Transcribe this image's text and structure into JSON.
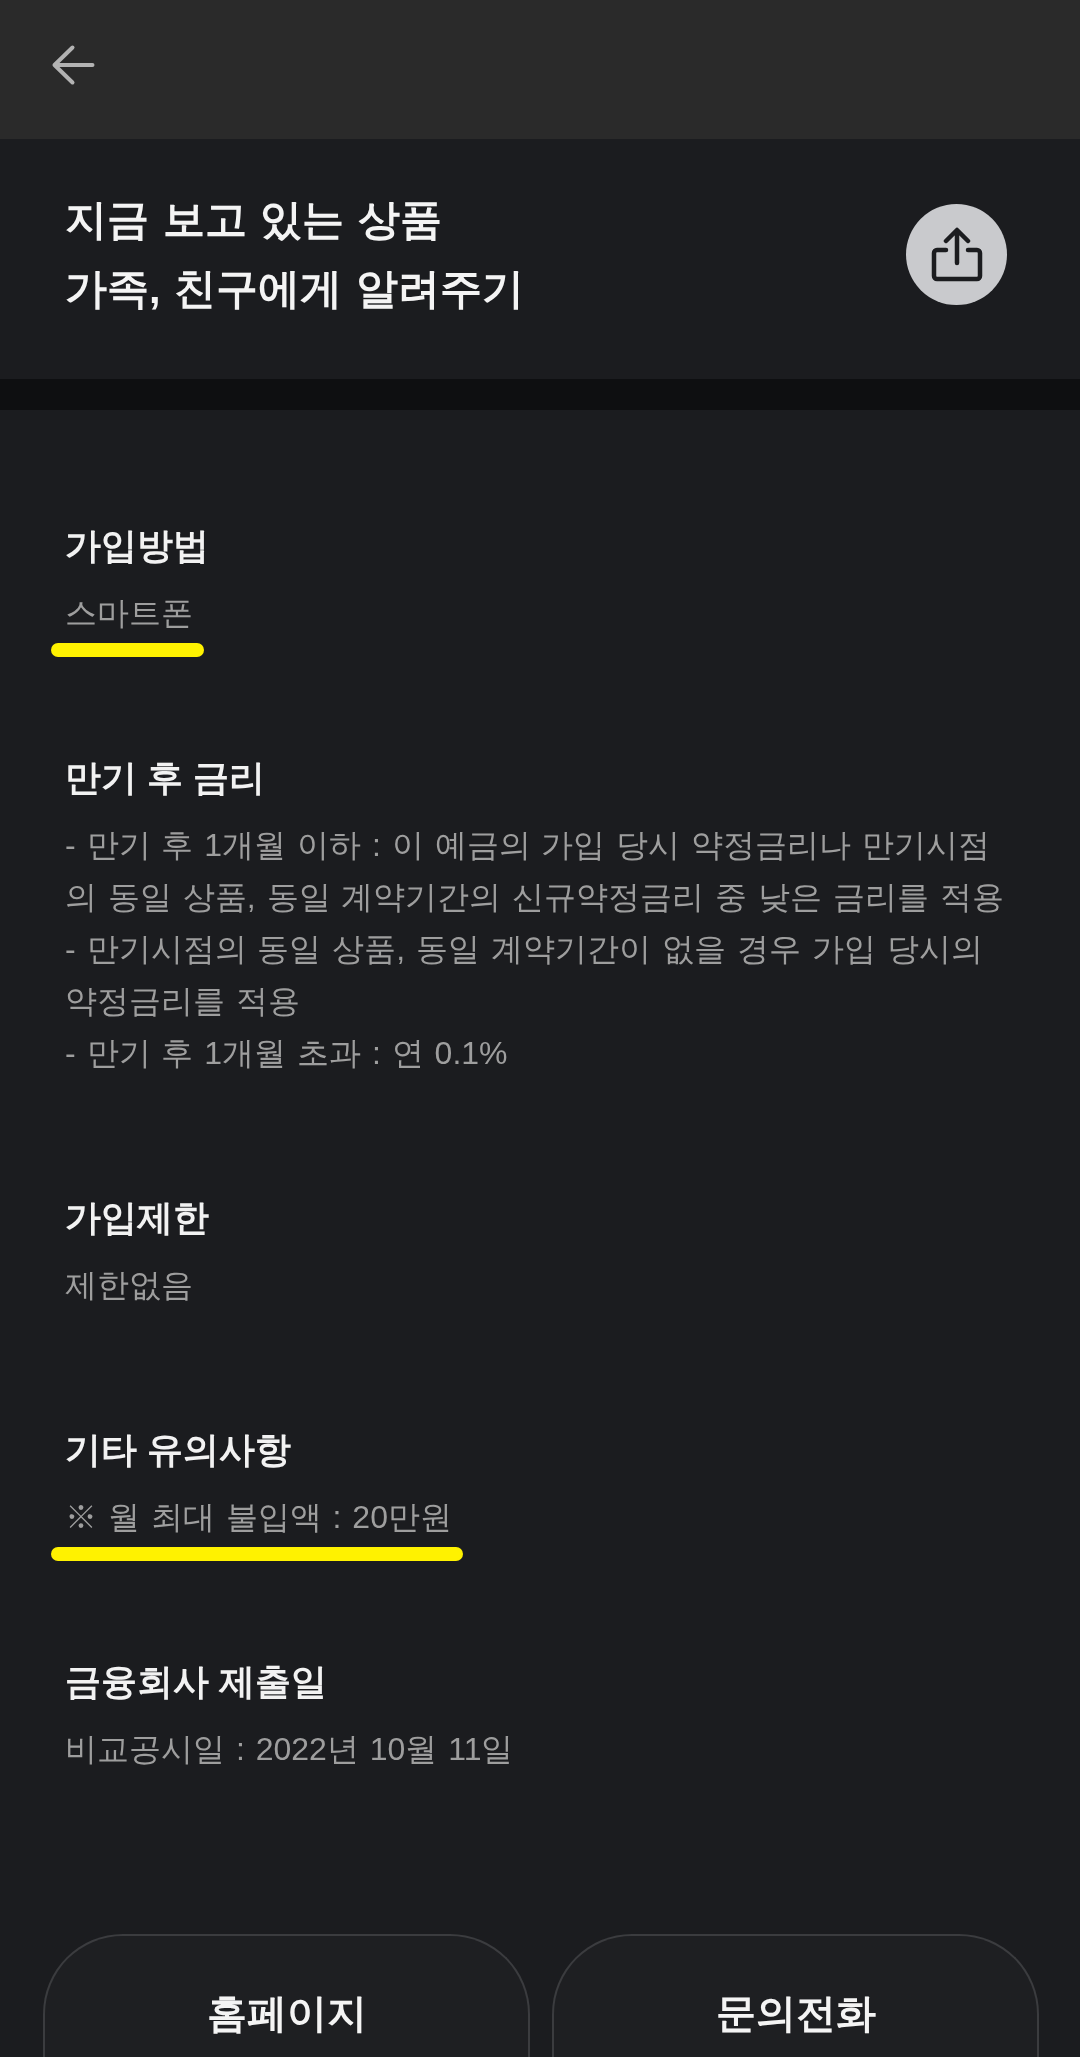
{
  "share_banner": {
    "title_lines": [
      "지금 보고 있는 상품",
      "가족, 친구에게 알려주기"
    ]
  },
  "sections": [
    {
      "heading": "가입방법",
      "body": [
        "스마트폰"
      ],
      "marked": true
    },
    {
      "heading": "만기 후 금리",
      "body": [
        "- 만기 후 1개월 이하 : 이 예금의 가입 당시 약정금리나 만기시점의 동일 상품, 동일 계약기간의 신규약정금리 중 낮은 금리를 적용",
        "- 만기시점의 동일 상품, 동일 계약기간이 없을 경우 가입 당시의 약정금리를 적용",
        "- 만기 후 1개월 초과 : 연 0.1%"
      ],
      "marked": false
    },
    {
      "heading": "가입제한",
      "body": [
        "제한없음"
      ],
      "marked": false
    },
    {
      "heading": "기타 유의사항",
      "body": [
        "※ 월 최대 불입액 : 20만원"
      ],
      "marked": true
    },
    {
      "heading": "금융회사 제출일",
      "body": [
        "비교공시일 : 2022년 10월 11일"
      ],
      "marked": false
    }
  ],
  "buttons": [
    "홈페이지",
    "문의전화"
  ]
}
